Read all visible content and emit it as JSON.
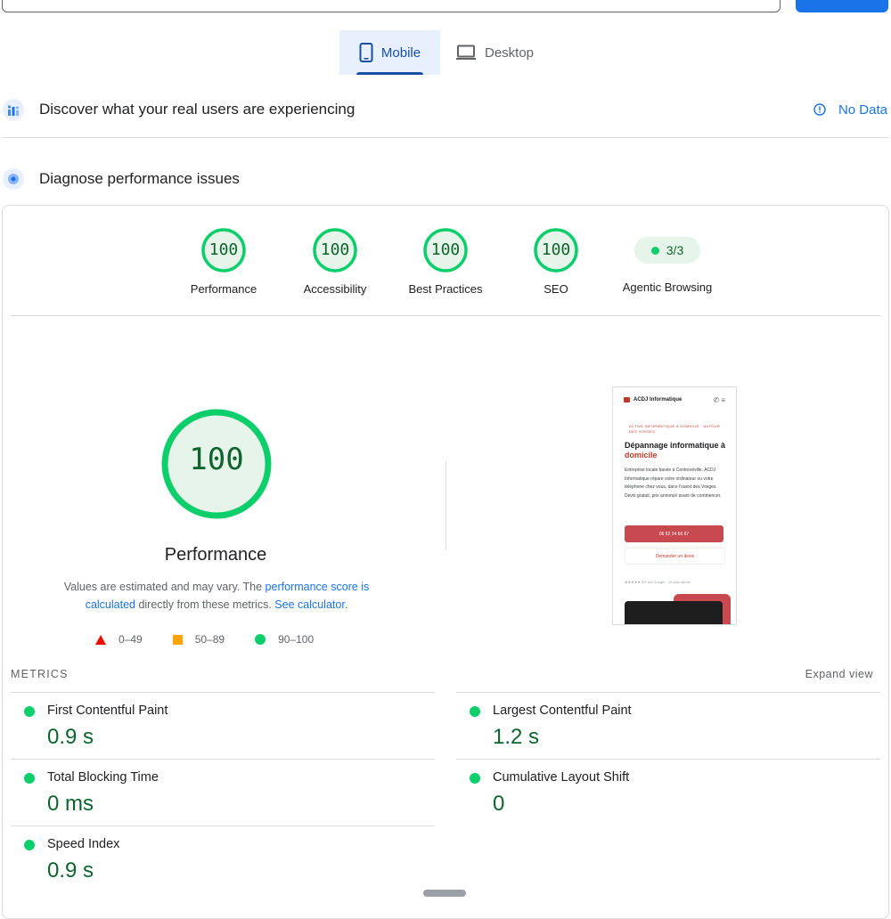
{
  "tabs": {
    "mobile_label": "Mobile",
    "desktop_label": "Desktop"
  },
  "discover": {
    "title": "Discover what your real users are experiencing",
    "status": "No Data"
  },
  "diagnose": {
    "title": "Diagnose performance issues"
  },
  "categories": [
    {
      "score": "100",
      "label": "Performance"
    },
    {
      "score": "100",
      "label": "Accessibility"
    },
    {
      "score": "100",
      "label": "Best Practices"
    },
    {
      "score": "100",
      "label": "SEO"
    }
  ],
  "agentic": {
    "score": "3/3",
    "label": "Agentic Browsing"
  },
  "performance": {
    "score": "100",
    "title": "Performance",
    "disclaimer_prefix": "Values are estimated and may vary. The ",
    "disclaimer_link1": "performance score is calculated",
    "disclaimer_middle": " directly from these metrics. ",
    "disclaimer_link2": "See calculator",
    "disclaimer_suffix": "."
  },
  "legend": {
    "fail": "0–49",
    "average": "50–89",
    "pass": "90–100"
  },
  "colors": {
    "pass": "#0cce6b",
    "average": "#ffa400",
    "fail": "#ff4e42",
    "accent": "#1a73e8"
  },
  "thumbnail": {
    "brand": "ACDJ Informatique",
    "kicker": "ACTIVE INFORMATIQUE À DOMICILE · AUTOUR DES VOSGES",
    "headline_main": "Dépannage informatique à",
    "headline_accent": "domicile",
    "body": "Entreprise locale basée à Contrexéville, ACDJ Informatique répare votre ordinateur ou votre téléphone chez vous, dans l'ouest des Vosges. Devis gratuit, prix annoncé avant de commencer.",
    "call_button": "06 52 24 66 67",
    "quote_button": "Demander un devis",
    "rating": "★★★★★ 5/5 sur Google · 14 avis clients"
  },
  "metrics": {
    "heading": "METRICS",
    "expand": "Expand view",
    "fcp": {
      "label": "First Contentful Paint",
      "value": "0.9 s"
    },
    "lcp": {
      "label": "Largest Contentful Paint",
      "value": "1.2 s"
    },
    "tbt": {
      "label": "Total Blocking Time",
      "value": "0 ms"
    },
    "cls": {
      "label": "Cumulative Layout Shift",
      "value": "0"
    },
    "si": {
      "label": "Speed Index",
      "value": "0.9 s"
    }
  }
}
